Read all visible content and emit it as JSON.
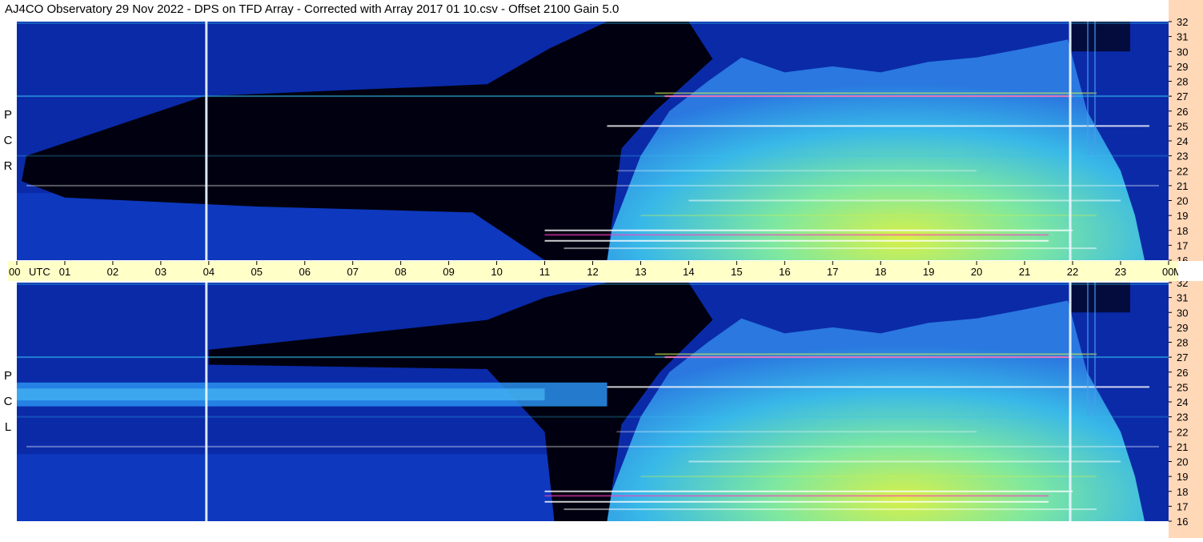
{
  "title": "AJ4CO Observatory  29 Nov 2022  -  DPS on TFD Array  -  Corrected with Array 2017 01 10.csv  -  Offset 2100  Gain 5.0",
  "panels": [
    {
      "id": "rcp",
      "label_letters": [
        "P",
        "C",
        "R"
      ]
    },
    {
      "id": "lcp",
      "label_letters": [
        "P",
        "C",
        "L"
      ]
    }
  ],
  "chart_data": {
    "type": "heatmap",
    "title": "AJ4CO Observatory  29 Nov 2022  -  DPS on TFD Array  -  Corrected with Array 2017 01 10.csv  -  Offset 2100  Gain 5.0",
    "x_axis": {
      "unit_label": "UTC",
      "ticks": [
        "00",
        "01",
        "02",
        "03",
        "04",
        "05",
        "06",
        "07",
        "08",
        "09",
        "10",
        "11",
        "12",
        "13",
        "14",
        "15",
        "16",
        "17",
        "18",
        "19",
        "20",
        "21",
        "22",
        "23",
        "00"
      ],
      "range_hours": [
        0,
        24
      ]
    },
    "y_axis": {
      "unit_label": "MHz",
      "ticks": [
        16,
        17,
        18,
        19,
        20,
        21,
        22,
        23,
        24,
        25,
        26,
        27,
        28,
        29,
        30,
        31,
        32
      ],
      "range_mhz": [
        16,
        32
      ]
    },
    "series": [
      {
        "name": "RCP",
        "description": "right circular polarization spectrogram"
      },
      {
        "name": "LCP",
        "description": "left circular polarization spectrogram"
      }
    ],
    "colormap": [
      "#000010",
      "#0a2aa8",
      "#1f6fe8",
      "#36c2f0",
      "#6ee8b0",
      "#c8f050",
      "#ff40c0",
      "#ffffff"
    ],
    "features": {
      "galactic_background_rise_start_utc": 12.3,
      "galactic_background_peak_utc": 20.0,
      "galactic_background_end_utc": 23.0,
      "vertical_interference_lines_utc": [
        3.95,
        21.95
      ],
      "strong_band_mhz": 27.0
    }
  },
  "colors": {
    "time_strip": "#ffffc8",
    "freq_strip": "#ffd8b8",
    "background_dark": "#000010",
    "background_blue": "#0a2aa8"
  }
}
